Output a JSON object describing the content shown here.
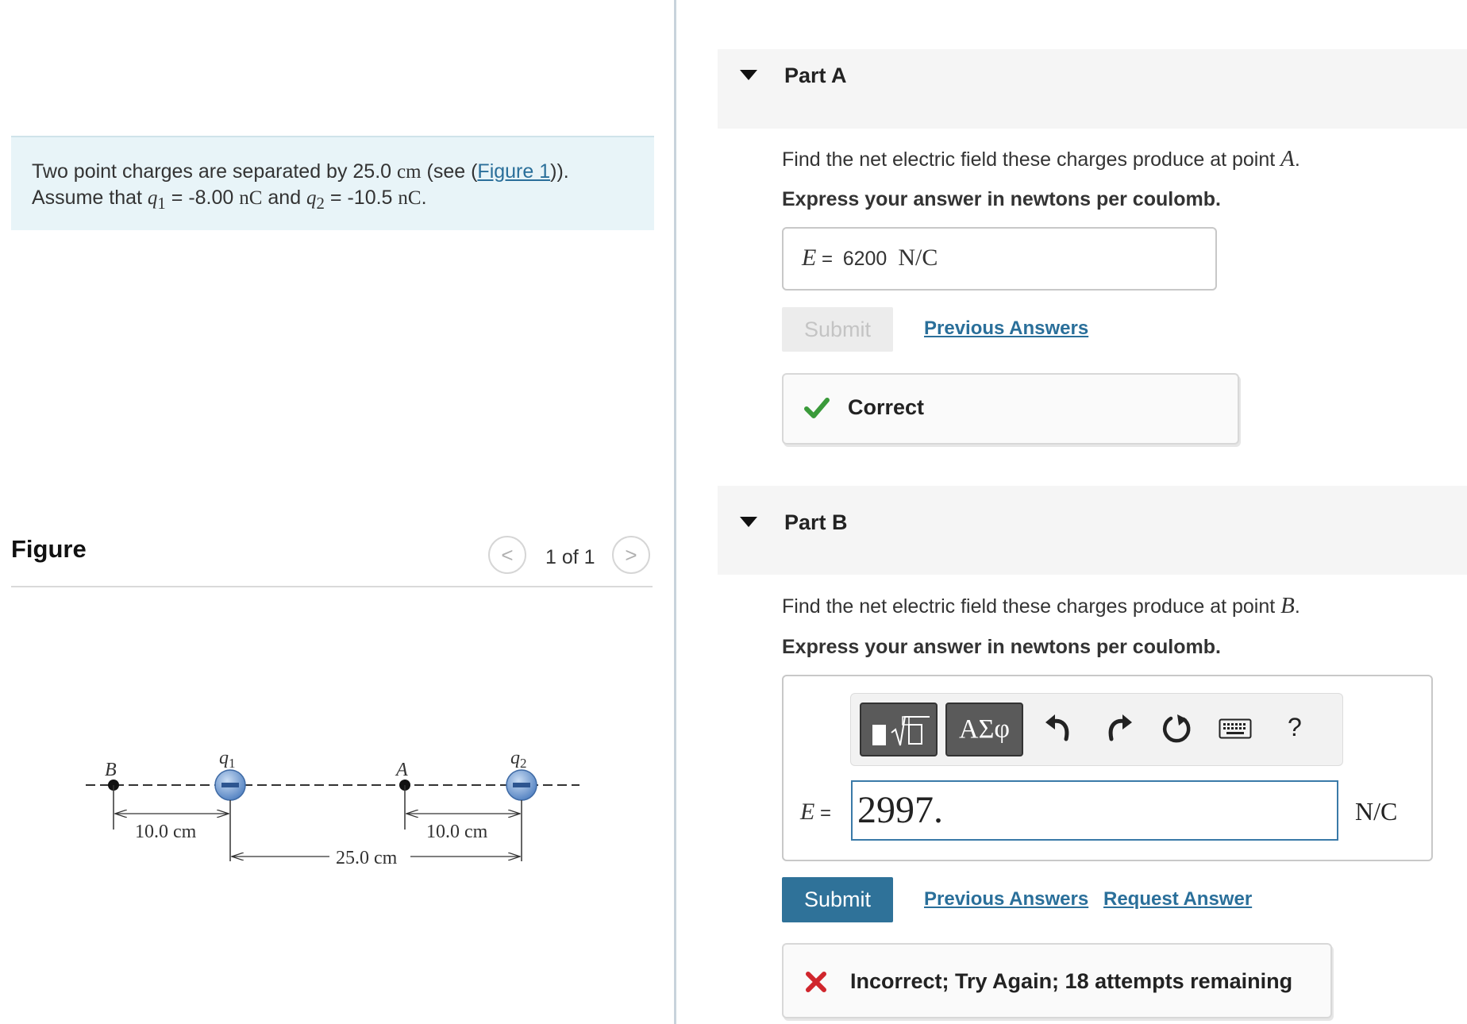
{
  "problem": {
    "text_1": "Two point charges are separated by 25.0 ",
    "unit_cm": "cm",
    "text_2": " (see (",
    "figure_link": "Figure 1",
    "text_3": ")).",
    "line2_1": "Assume that ",
    "q1_sym": "q",
    "q1_sub": "1",
    "q1_val": " = -8.00 ",
    "nC_unit": "nC",
    "and": " and ",
    "q2_sym": "q",
    "q2_sub": "2",
    "q2_val": " = -10.5 ",
    "nC_unit2": "nC",
    "period": "."
  },
  "figure": {
    "title": "Figure",
    "counter": "1 of 1",
    "prev": "<",
    "next": ">",
    "label_B": "B",
    "label_A": "A",
    "label_q1": "q",
    "label_q1_sub": "1",
    "label_q2": "q",
    "label_q2_sub": "2",
    "dist_left": "10.0 cm",
    "dist_right": "10.0 cm",
    "dist_total": "25.0 cm",
    "charge_color": "#6f9bd4"
  },
  "partA": {
    "title": "Part A",
    "question": "Find the net electric field these charges produce at point ",
    "point": "A",
    "question_end": ".",
    "instruction": "Express your answer in newtons per coulomb.",
    "var": "E",
    "equals": " = ",
    "value": "6200",
    "unit": "N/C",
    "submit": "Submit",
    "previous_answers": "Previous Answers",
    "feedback": "Correct",
    "feedback_color": "#3a9a3a"
  },
  "partB": {
    "title": "Part B",
    "question": "Find the net electric field these charges produce at point ",
    "point": "B",
    "question_end": ".",
    "instruction": "Express your answer in newtons per coulomb.",
    "var": "E",
    "equals": " = ",
    "value": "2997.",
    "unit": "N/C",
    "symbols_label": "ΑΣφ",
    "help_label": "?",
    "submit": "Submit",
    "previous_answers": "Previous Answers",
    "request_answer": "Request Answer",
    "feedback": "Incorrect; Try Again; 18 attempts remaining",
    "feedback_color": "#d0262d"
  }
}
